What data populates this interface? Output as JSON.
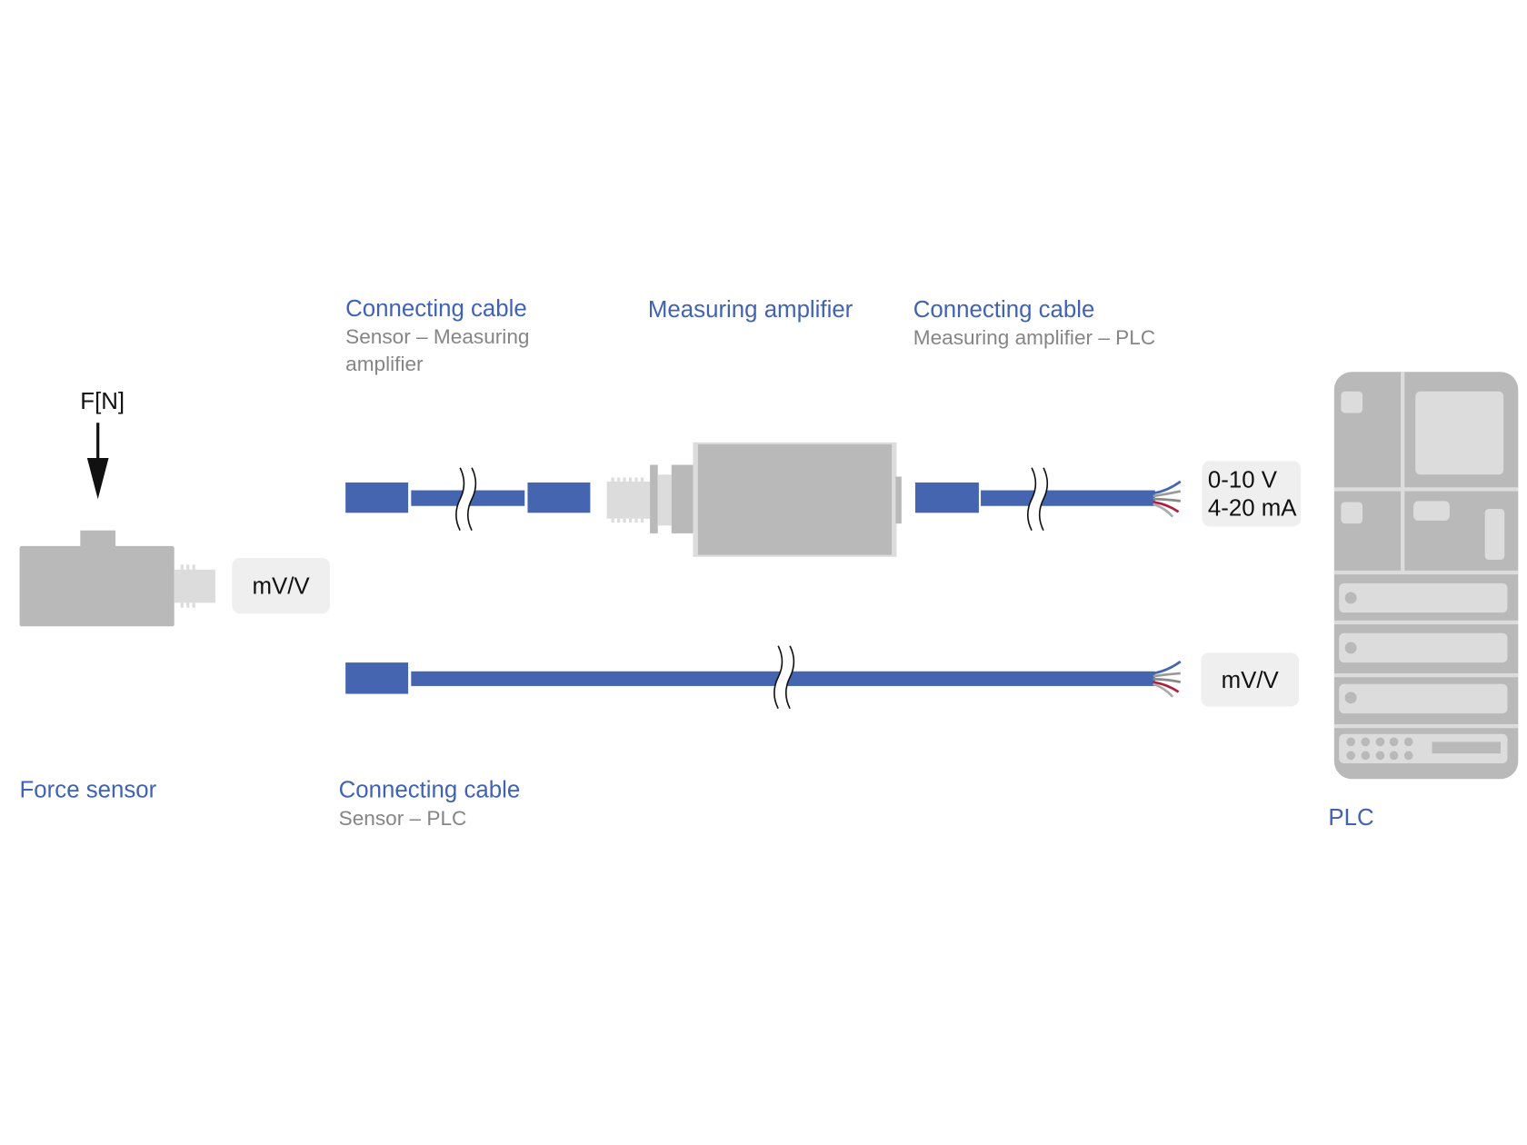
{
  "force_sensor": {
    "force_label": "F[N]",
    "output_label": "mV/V",
    "title": "Force sensor"
  },
  "cable_sensor_amplifier": {
    "title": "Connecting cable",
    "subtitle_line1": "Sensor – Measuring",
    "subtitle_line2": "amplifier"
  },
  "amplifier": {
    "title": "Measuring amplifier"
  },
  "cable_amplifier_plc": {
    "title": "Connecting cable",
    "subtitle": "Measuring amplifier – PLC",
    "output_line1": "0-10 V",
    "output_line2": "4-20 mA"
  },
  "cable_sensor_plc": {
    "title": "Connecting cable",
    "subtitle": "Sensor – PLC",
    "output_label": "mV/V"
  },
  "plc": {
    "title": "PLC"
  },
  "colors": {
    "cable": "#4565b0",
    "device": "#b8b9b8",
    "label_blue": "#4062b4",
    "label_grey": "#858585",
    "wire_red": "#b0203c"
  }
}
